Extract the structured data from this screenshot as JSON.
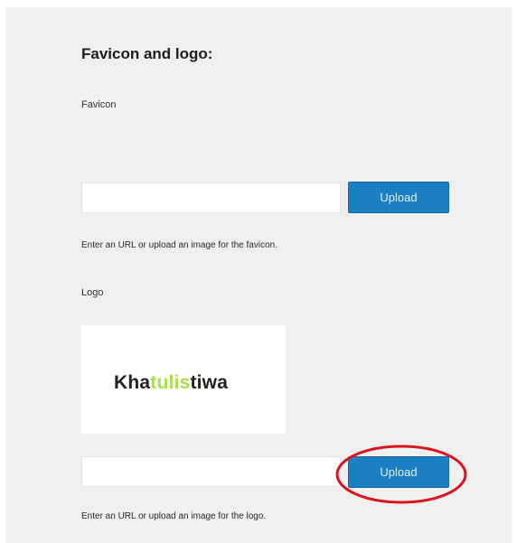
{
  "section": {
    "title": "Favicon and logo:"
  },
  "favicon": {
    "label": "Favicon",
    "input_value": "",
    "upload_label": "Upload",
    "help": "Enter an URL or upload an image for the favicon."
  },
  "logo": {
    "label": "Logo",
    "preview": {
      "part1": "Kha",
      "part2": "tulis",
      "part3": "tiwa"
    },
    "input_value": "",
    "upload_label": "Upload",
    "help": "Enter an URL or upload an image for the logo."
  },
  "colors": {
    "panel_background": "#efefef",
    "button_blue": "#1a7fc3",
    "highlight_red": "#d8141e",
    "logo_green": "#a8e04a"
  }
}
